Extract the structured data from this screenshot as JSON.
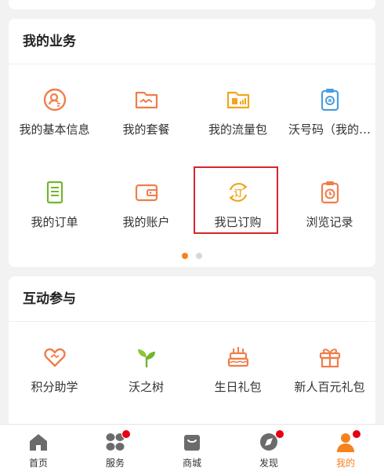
{
  "business": {
    "title": "我的业务",
    "items": [
      {
        "label": "我的基本信息",
        "icon": "profile-badge-icon"
      },
      {
        "label": "我的套餐",
        "icon": "plan-folder-icon"
      },
      {
        "label": "我的流量包",
        "icon": "data-package-icon"
      },
      {
        "label": "沃号码（我的…",
        "icon": "number-clipboard-icon"
      },
      {
        "label": "我的订单",
        "icon": "order-list-icon"
      },
      {
        "label": "我的账户",
        "icon": "wallet-icon"
      },
      {
        "label": "我已订购",
        "icon": "subscribed-refresh-icon",
        "icon_text": "订"
      },
      {
        "label": "浏览记录",
        "icon": "history-clock-icon"
      }
    ],
    "selected_item": "我已订购",
    "page_dots": {
      "count": 2,
      "active": 1
    }
  },
  "interact": {
    "title": "互动参与",
    "items": [
      {
        "label": "积分助学",
        "icon": "heart-icon"
      },
      {
        "label": "沃之树",
        "icon": "sprout-icon"
      },
      {
        "label": "生日礼包",
        "icon": "birthday-cake-icon"
      },
      {
        "label": "新人百元礼包",
        "icon": "gift-box-icon"
      }
    ]
  },
  "tabbar": {
    "tabs": [
      {
        "label": "首页",
        "icon": "home-icon",
        "active": false,
        "badge": false
      },
      {
        "label": "服务",
        "icon": "service-grid-icon",
        "active": false,
        "badge": true
      },
      {
        "label": "商城",
        "icon": "shopping-bag-icon",
        "active": false,
        "badge": false
      },
      {
        "label": "发现",
        "icon": "compass-icon",
        "active": false,
        "badge": true
      },
      {
        "label": "我的",
        "icon": "person-icon",
        "active": true,
        "badge": true
      }
    ]
  },
  "colors": {
    "accent": "#f5821f",
    "icon_orange": "#f07d4a",
    "icon_yellow": "#f3a51a",
    "icon_blue": "#4a9de0",
    "icon_green": "#72b52e",
    "highlight_border": "#d7262a",
    "badge": "#e60012",
    "tab_icon_gray": "#6b6b6b"
  }
}
